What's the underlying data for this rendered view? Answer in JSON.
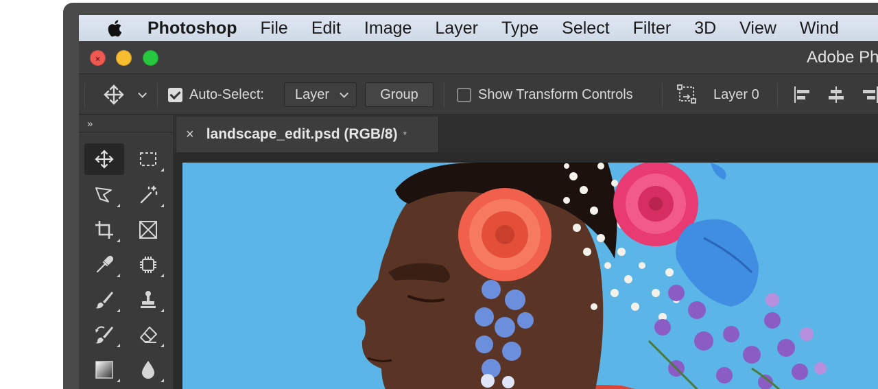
{
  "menubar": {
    "app_name": "Photoshop",
    "items": [
      "File",
      "Edit",
      "Image",
      "Layer",
      "Type",
      "Select",
      "Filter",
      "3D",
      "View",
      "Wind"
    ]
  },
  "window": {
    "title": "Adobe Ph"
  },
  "options": {
    "auto_select_label": "Auto-Select:",
    "auto_select_checked": true,
    "target_value": "Layer",
    "group_label": "Group",
    "show_transform_label": "Show Transform Controls",
    "show_transform_checked": false,
    "layer_label": "Layer 0"
  },
  "document": {
    "tab_name": "landscape_edit.psd (RGB/8)",
    "modified_mark": "*",
    "close_glyph": "×"
  },
  "toolbar": {
    "collapse_glyph": "»",
    "tools": [
      "move",
      "rectangular-marquee",
      "lasso",
      "magic-wand",
      "crop",
      "frame",
      "eyedropper",
      "spot-healing",
      "brush",
      "clone-stamp",
      "history-brush",
      "eraser",
      "gradient",
      "blur"
    ]
  },
  "colors": {
    "canvas_background": "#5ab4e6",
    "panel": "#3a3a3a",
    "menubar": "#d8e1ec"
  }
}
